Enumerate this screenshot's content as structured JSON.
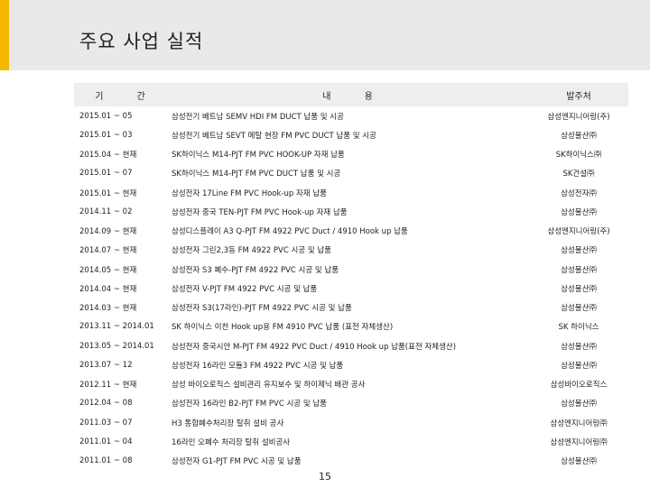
{
  "title": "주요 사업 실적",
  "table": {
    "headers": {
      "period": "기 간",
      "content": "내 용",
      "client": "발주처"
    },
    "rows": [
      {
        "period": "2015.01 ~ 05",
        "content": "삼성전기 베트남 SEMV HDI FM DUCT 납품 및 시공",
        "client": "삼성엔지니어링(주)"
      },
      {
        "period": "2015.01 ~ 03",
        "content": "삼성전기 베트남 SEVT 메탈 현장 FM PVC DUCT 납품 및 시공",
        "client": "삼성물산㈜"
      },
      {
        "period": "2015.04 ~ 현재",
        "content": "SK하이닉스 M14-PJT FM PVC HOOK-UP 자재 납품",
        "client": "SK하이닉스㈜"
      },
      {
        "period": "2015.01 ~ 07",
        "content": "SK하이닉스 M14-PJT FM PVC DUCT 납품 및 시공",
        "client": "SK건설㈜"
      },
      {
        "period": "2015.01 ~ 현재",
        "content": "삼성전자 17Line FM PVC Hook-up 자재 납품",
        "client": "삼성전자㈜"
      },
      {
        "period": "2014.11 ~ 02",
        "content": "삼성전자 중국 TEN-PJT FM PVC Hook-up 자재 납품",
        "client": "삼성물산㈜"
      },
      {
        "period": "2014.09 ~ 현재",
        "content": "삼성디스플레이 A3 Q-PJT FM 4922 PVC Duct / 4910 Hook up 납품",
        "client": "삼성엔지니어링(주)"
      },
      {
        "period": "2014.07 ~ 현재",
        "content": "삼성전자 그린2,3동 FM 4922 PVC 시공 및 납품",
        "client": "삼성물산㈜"
      },
      {
        "period": "2014.05 ~ 현재",
        "content": "삼성전자 S3 폐수-PJT FM 4922 PVC 시공 및 납품",
        "client": "삼성물산㈜"
      },
      {
        "period": "2014.04 ~ 현재",
        "content": "삼성전자 V-PJT FM 4922 PVC 시공 및 납품",
        "client": "삼성물산㈜"
      },
      {
        "period": "2014.03 ~ 현재",
        "content": "삼성전자 S3(17라인)-PJT FM 4922 PVC 시공 및 납품",
        "client": "삼성물산㈜"
      },
      {
        "period": "2013.11 ~ 2014.01",
        "content": "SK 하이닉스 이천 Hook up용 FM 4910 PVC 납품 (표전 자체생산)",
        "client": "SK 하이닉스"
      },
      {
        "period": "2013.05 ~ 2014.01",
        "content": "삼성전자 중국시안 M-PJT FM 4922 PVC Duct / 4910 Hook up 납품(표전 자체생산)",
        "client": "삼성물산㈜"
      },
      {
        "period": "2013.07 ~ 12",
        "content": "삼성전자 16라인 모듈3 FM 4922 PVC 시공 및 납품",
        "client": "삼성물산㈜"
      },
      {
        "period": "2012.11 ~ 현재",
        "content": "삼성 바이오로직스 설비관리 유지보수 및 하이제닉 배관 공사",
        "client": "삼성바이오로직스"
      },
      {
        "period": "2012.04 ~ 08",
        "content": "삼성전자 16라인 B2-PJT FM PVC 시공 및 납품",
        "client": "삼성물산㈜"
      },
      {
        "period": "2011.03 ~ 07",
        "content": "H3 통합폐수처리장 탈취 설비 공사",
        "client": "삼성엔지니어링㈜"
      },
      {
        "period": "2011.01 ~ 04",
        "content": "16라인 오폐수 처리장 탈취 설비공사",
        "client": "삼성엔지니어링㈜"
      },
      {
        "period": "2011.01 ~ 08",
        "content": "삼성전자 G1-PJT FM PVC 시공 및 납품",
        "client": "삼성물산㈜"
      }
    ]
  },
  "page_number": "15",
  "colors": {
    "accent": "#f5b800",
    "header_band": "#e9e9e9",
    "table_header": "#eeeeee"
  }
}
